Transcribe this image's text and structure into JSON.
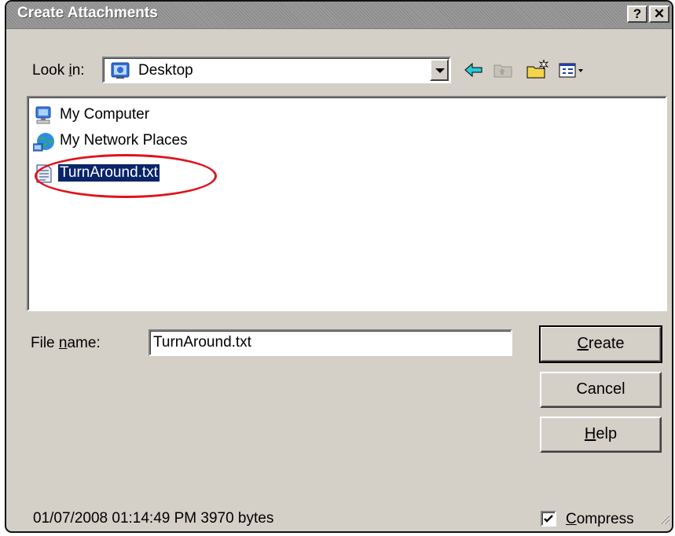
{
  "window": {
    "title": "Create Attachments",
    "help_button": "?",
    "close_button": "✕"
  },
  "lookin": {
    "label_pre": "Look ",
    "label_ul": "i",
    "label_post": "n:",
    "value": "Desktop",
    "icon": "desktop-icon"
  },
  "toolbar": {
    "icons": [
      "back-arrow-icon",
      "up-folder-icon",
      "new-folder-icon",
      "view-menu-icon"
    ]
  },
  "files": [
    {
      "name": "My Computer",
      "icon": "my-computer-icon",
      "selected": false
    },
    {
      "name": "My Network Places",
      "icon": "network-places-icon",
      "selected": false
    },
    {
      "name": "TurnAround.txt",
      "icon": "text-file-icon",
      "selected": true
    }
  ],
  "filename": {
    "label_pre": "File ",
    "label_ul": "n",
    "label_post": "ame:",
    "value": "TurnAround.txt"
  },
  "buttons": {
    "create_ul": "C",
    "create_rest": "reate",
    "cancel": "Cancel",
    "help_ul": "H",
    "help_rest": "elp"
  },
  "status": {
    "text": "01/07/2008 01:14:49 PM 3970 bytes"
  },
  "compress": {
    "label_ul": "C",
    "label_rest": "ompress",
    "checked": true
  },
  "colors": {
    "selection": "#0a246a",
    "highlight_oval": "#e0141c",
    "dialog_bg": "#d4d0c8"
  }
}
